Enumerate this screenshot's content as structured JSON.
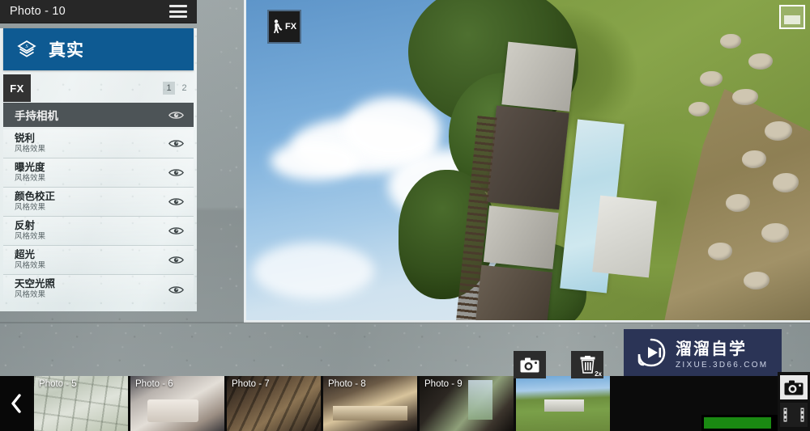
{
  "window": {
    "title": "Photo - 10",
    "menu_icon": "hamburger-icon"
  },
  "mode_bar": {
    "icon": "layers-stack-icon",
    "label": "真实"
  },
  "fx_tab": {
    "label": "FX",
    "pages": [
      {
        "number": "1",
        "active": true
      },
      {
        "number": "2",
        "active": false
      }
    ]
  },
  "fx_panel": {
    "header": {
      "label": "手持相机",
      "visibility_icon": "eye-icon"
    },
    "items": [
      {
        "name": "锐利",
        "subtitle": "风格效果",
        "visibility_icon": "eye-icon"
      },
      {
        "name": "曝光度",
        "subtitle": "风格效果",
        "visibility_icon": "eye-icon"
      },
      {
        "name": "颜色校正",
        "subtitle": "风格效果",
        "visibility_icon": "eye-icon"
      },
      {
        "name": "反射",
        "subtitle": "风格效果",
        "visibility_icon": "eye-icon"
      },
      {
        "name": "超光",
        "subtitle": "风格效果",
        "visibility_icon": "eye-icon"
      },
      {
        "name": "天空光照",
        "subtitle": "风格效果",
        "visibility_icon": "eye-icon"
      }
    ]
  },
  "viewport": {
    "fx_overlay_label": "FX",
    "fx_overlay_icon": "person-painting-icon",
    "minimap_icon": "navigation-box-icon",
    "render_description": "航拍建筑渲染图"
  },
  "toolbar": {
    "snapshot_icon": "camera-icon",
    "snapshot_label": "",
    "delete_icon": "trash-icon",
    "delete_badge": "2x"
  },
  "filmstrip": {
    "prev_icon": "chevron-left-icon",
    "thumbnails": [
      {
        "label": "Photo - 5",
        "selected": false,
        "art": "th5"
      },
      {
        "label": "Photo - 6",
        "selected": false,
        "art": "th6"
      },
      {
        "label": "Photo - 7",
        "selected": false,
        "art": "th7"
      },
      {
        "label": "Photo - 8",
        "selected": false,
        "art": "th8"
      },
      {
        "label": "Photo - 9",
        "selected": false,
        "art": "th9"
      },
      {
        "label": "",
        "selected": true,
        "art": "th10"
      }
    ]
  },
  "watermark": {
    "icon": "play-logo-icon",
    "title": "溜溜自学",
    "subtitle": "ZIXUE.3D66.COM"
  },
  "right_rail": {
    "camera_icon": "camera-icon",
    "film_icon": "film-strip-icon"
  },
  "progress": {
    "percent": "86"
  },
  "colors": {
    "accent_blue": "#0e5a92",
    "selection_orange": "#e0491f",
    "progress_green": "#1a8a12",
    "titlebar_dark": "#272727",
    "watermark_navy": "#2b3456"
  }
}
